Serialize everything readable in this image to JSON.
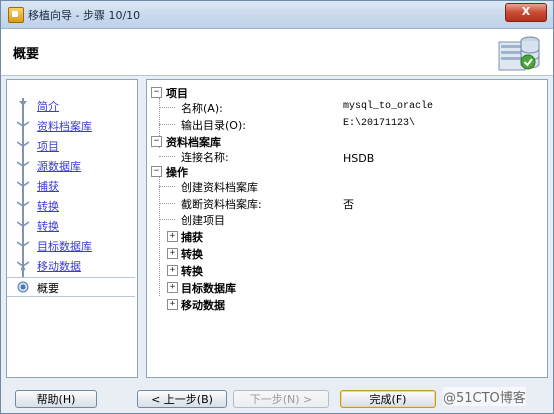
{
  "window": {
    "title": "移植向导 - 步骤 10/10",
    "close_label": "X"
  },
  "header": {
    "title": "概要",
    "icon": "database-wizard-icon"
  },
  "nav": {
    "items": [
      {
        "label": "简介"
      },
      {
        "label": "资料档案库"
      },
      {
        "label": "项目"
      },
      {
        "label": "源数据库"
      },
      {
        "label": "捕获"
      },
      {
        "label": "转换"
      },
      {
        "label": "转换"
      },
      {
        "label": "目标数据库"
      },
      {
        "label": "移动数据"
      },
      {
        "label": "概要"
      }
    ],
    "active_index": 9
  },
  "tree": {
    "project": {
      "label": "项目",
      "name_key": "名称(A):",
      "name_value": "mysql_to_oracle",
      "output_key": "输出目录(O):",
      "output_value": "E:\\20171123\\"
    },
    "repository": {
      "label": "资料档案库",
      "conn_key": "连接名称:",
      "conn_value": "HSDB"
    },
    "operations": {
      "label": "操作",
      "create_repo": "创建资料档案库",
      "truncate_key": "截断资料档案库:",
      "truncate_value": "否",
      "create_project": "创建项目",
      "children": [
        "捕获",
        "转换",
        "转换",
        "目标数据库",
        "移动数据"
      ]
    }
  },
  "footer": {
    "help": "帮助(H)",
    "back": "< 上一步(B)",
    "next": "下一步(N) >",
    "finish": "完成(F)"
  },
  "watermark": "@51CTO博客"
}
